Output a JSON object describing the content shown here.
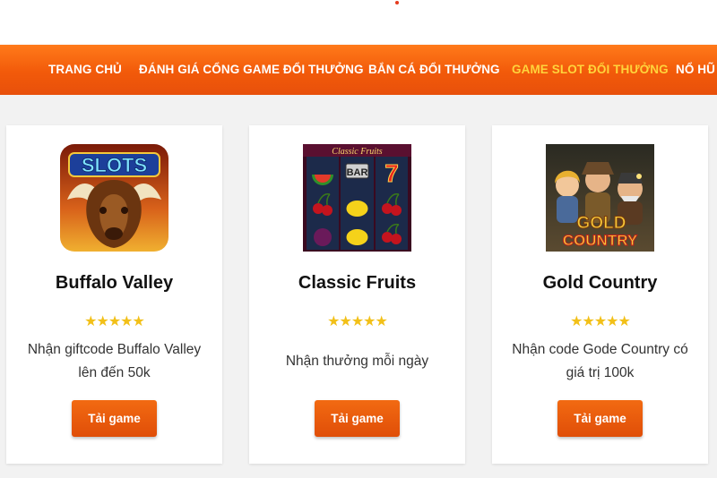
{
  "nav": {
    "items": [
      {
        "label": "TRANG CHỦ"
      },
      {
        "label": "ĐÁNH GIÁ CỔNG GAME ĐỔI THƯỞNG"
      },
      {
        "label": "BẮN CÁ ĐỔI THƯỞNG"
      },
      {
        "label": "GAME SLOT ĐỔI THƯỞNG"
      },
      {
        "label": "NỔ HŨ"
      }
    ],
    "active_index": 3,
    "colors": {
      "bar": "#f25a0a",
      "text": "#ffffff",
      "active_text": "#ffd43b"
    }
  },
  "rating_stars": "★★★★★",
  "cards": [
    {
      "title": "Buffalo Valley",
      "desc": "Nhận giftcode Buffalo Valley lên đến 50k",
      "button": "Tải game",
      "image_text": "SLOTS",
      "icon": "buffalo-slots-icon"
    },
    {
      "title": "Classic Fruits",
      "desc": "Nhận thưởng mỗi ngày",
      "button": "Tải game",
      "image_text": "Classic Fruits",
      "image_text_2": "BAR",
      "icon": "fruit-slot-reels-icon"
    },
    {
      "title": "Gold Country",
      "desc": "Nhận code Gode Country có giá trị 100k",
      "button": "Tải game",
      "image_text": "GOLD",
      "image_text_2": "COUNTRY",
      "icon": "gold-country-miners-icon"
    }
  ],
  "colors": {
    "button": "#e8570b",
    "stars": "#f2c018",
    "background": "#f2f2f2"
  }
}
